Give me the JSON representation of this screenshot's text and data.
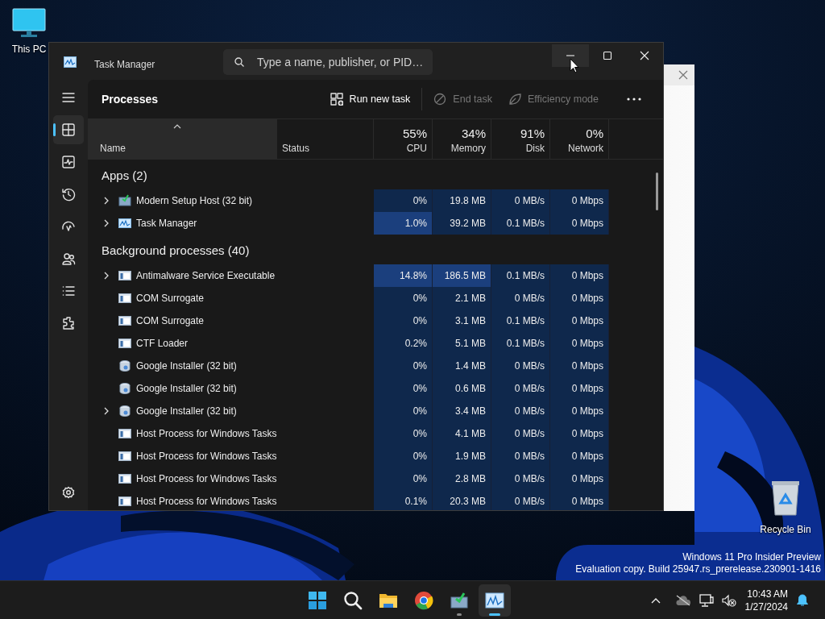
{
  "desktop_icons": [
    {
      "label": "This PC",
      "kind": "computer"
    },
    {
      "label": "Recycle Bin",
      "kind": "recycle"
    }
  ],
  "window": {
    "title": "Task Manager",
    "search": {
      "placeholder": "Type a name, publisher, or PID…"
    },
    "controls": [
      {
        "kind": "minimize",
        "hovered": true
      },
      {
        "kind": "maximize",
        "hovered": false
      },
      {
        "kind": "close",
        "hovered": false
      }
    ]
  },
  "sidebar": {
    "items": [
      {
        "kind": "processes",
        "selected": true
      },
      {
        "kind": "performance",
        "selected": false
      },
      {
        "kind": "history",
        "selected": false
      },
      {
        "kind": "startup",
        "selected": false
      },
      {
        "kind": "users",
        "selected": false
      },
      {
        "kind": "details",
        "selected": false
      },
      {
        "kind": "services",
        "selected": false
      }
    ]
  },
  "toolbar": {
    "title": "Processes",
    "actions": [
      {
        "label": "Run new task",
        "kind": "run",
        "disabled": false
      },
      {
        "label": "End task",
        "kind": "end",
        "disabled": true
      },
      {
        "label": "Efficiency mode",
        "kind": "efficiency",
        "disabled": true
      }
    ]
  },
  "table": {
    "columns": [
      {
        "label": "Name",
        "sorted": true
      },
      {
        "label": "Status",
        "sorted": false
      },
      {
        "label": "CPU",
        "usage": "55%",
        "sorted": false
      },
      {
        "label": "Memory",
        "usage": "34%",
        "sorted": false
      },
      {
        "label": "Disk",
        "usage": "91%",
        "sorted": false
      },
      {
        "label": "Network",
        "usage": "0%",
        "sorted": false
      }
    ],
    "groups": [
      {
        "title": "Apps (2)",
        "rows": [
          {
            "name": "Modern Setup Host (32 bit)",
            "kind": "setup",
            "expandable": true,
            "values": [
              "0%",
              "19.8 MB",
              "0 MB/s",
              "0 Mbps"
            ],
            "hot": [
              false,
              false,
              false,
              false
            ]
          },
          {
            "name": "Task Manager",
            "kind": "taskmgr",
            "expandable": true,
            "values": [
              "1.0%",
              "39.2 MB",
              "0.1 MB/s",
              "0 Mbps"
            ],
            "hot": [
              true,
              false,
              false,
              false
            ]
          }
        ]
      },
      {
        "title": "Background processes (40)",
        "rows": [
          {
            "name": "Antimalware Service Executable",
            "kind": "service",
            "expandable": true,
            "values": [
              "14.8%",
              "186.5 MB",
              "0.1 MB/s",
              "0 Mbps"
            ],
            "hot": [
              true,
              true,
              false,
              false
            ]
          },
          {
            "name": "COM Surrogate",
            "kind": "service",
            "expandable": false,
            "values": [
              "0%",
              "2.1 MB",
              "0 MB/s",
              "0 Mbps"
            ],
            "hot": [
              false,
              false,
              false,
              false
            ]
          },
          {
            "name": "COM Surrogate",
            "kind": "service",
            "expandable": false,
            "values": [
              "0%",
              "3.1 MB",
              "0.1 MB/s",
              "0 Mbps"
            ],
            "hot": [
              false,
              false,
              false,
              false
            ]
          },
          {
            "name": "CTF Loader",
            "kind": "service",
            "expandable": false,
            "values": [
              "0.2%",
              "5.1 MB",
              "0.1 MB/s",
              "0 Mbps"
            ],
            "hot": [
              false,
              false,
              false,
              false
            ]
          },
          {
            "name": "Google Installer (32 bit)",
            "kind": "installer",
            "expandable": false,
            "values": [
              "0%",
              "1.4 MB",
              "0 MB/s",
              "0 Mbps"
            ],
            "hot": [
              false,
              false,
              false,
              false
            ]
          },
          {
            "name": "Google Installer (32 bit)",
            "kind": "installer",
            "expandable": false,
            "values": [
              "0%",
              "0.6 MB",
              "0 MB/s",
              "0 Mbps"
            ],
            "hot": [
              false,
              false,
              false,
              false
            ]
          },
          {
            "name": "Google Installer (32 bit)",
            "kind": "installer",
            "expandable": true,
            "values": [
              "0%",
              "3.4 MB",
              "0 MB/s",
              "0 Mbps"
            ],
            "hot": [
              false,
              false,
              false,
              false
            ]
          },
          {
            "name": "Host Process for Windows Tasks",
            "kind": "service",
            "expandable": false,
            "values": [
              "0%",
              "4.1 MB",
              "0 MB/s",
              "0 Mbps"
            ],
            "hot": [
              false,
              false,
              false,
              false
            ]
          },
          {
            "name": "Host Process for Windows Tasks",
            "kind": "service",
            "expandable": false,
            "values": [
              "0%",
              "1.9 MB",
              "0 MB/s",
              "0 Mbps"
            ],
            "hot": [
              false,
              false,
              false,
              false
            ]
          },
          {
            "name": "Host Process for Windows Tasks",
            "kind": "service",
            "expandable": false,
            "values": [
              "0%",
              "2.8 MB",
              "0 MB/s",
              "0 Mbps"
            ],
            "hot": [
              false,
              false,
              false,
              false
            ]
          },
          {
            "name": "Host Process for Windows Tasks",
            "kind": "service",
            "expandable": false,
            "values": [
              "0.1%",
              "20.3 MB",
              "0 MB/s",
              "0 Mbps"
            ],
            "hot": [
              false,
              false,
              false,
              false
            ]
          }
        ]
      }
    ]
  },
  "build_info": [
    "Windows 11 Pro Insider Preview",
    "Evaluation copy. Build 25947.rs_prerelease.230901-1416"
  ],
  "taskbar": {
    "apps": [
      {
        "kind": "start",
        "running": false,
        "active": false
      },
      {
        "kind": "search",
        "running": false,
        "active": false
      },
      {
        "kind": "explorer",
        "running": false,
        "active": false
      },
      {
        "kind": "browser",
        "running": false,
        "active": false
      },
      {
        "kind": "setup",
        "running": true,
        "active": false
      },
      {
        "kind": "taskmgr",
        "running": true,
        "active": true
      }
    ],
    "clock": {
      "time": "10:43 AM",
      "date": "1/27/2024"
    }
  }
}
